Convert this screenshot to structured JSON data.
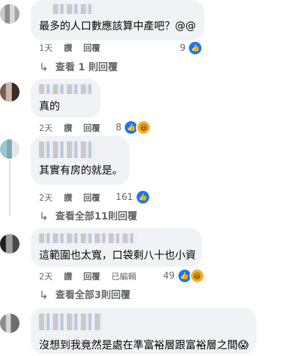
{
  "comments": [
    {
      "text": "最多的人口數應該算中產吧？@@",
      "time": "1天",
      "like": "讚",
      "reply": "回覆",
      "edited": "",
      "reaction_count": "9",
      "reactions": [
        "like"
      ]
    },
    {
      "text": "真的",
      "time": "2天",
      "like": "讚",
      "reply": "回覆",
      "edited": "",
      "reaction_count": "8",
      "reactions": [
        "like",
        "haha"
      ]
    },
    {
      "text": "其實有房的就是。",
      "time": "2天",
      "like": "讚",
      "reply": "回覆",
      "edited": "",
      "reaction_count": "161",
      "reactions": [
        "like"
      ]
    },
    {
      "text": "這範圍也太寬，口袋剩八十也小資",
      "time": "2天",
      "like": "讚",
      "reply": "回覆",
      "edited": "已編輯",
      "reaction_count": "49",
      "reactions": [
        "like",
        "haha"
      ]
    },
    {
      "text": "沒想到我竟然是處在準富裕層跟富裕層之間😱",
      "time": "",
      "like": "",
      "reply": "",
      "edited": "",
      "reaction_count": "",
      "reactions": []
    }
  ],
  "view_replies": [
    "查看 1 則回覆",
    "查看全部11則回覆",
    "查看全部3則回覆"
  ],
  "colors": {
    "bubble": "#f0f2f5",
    "meta": "#65676b",
    "like": "#1877f2",
    "haha": "#f7b125"
  }
}
